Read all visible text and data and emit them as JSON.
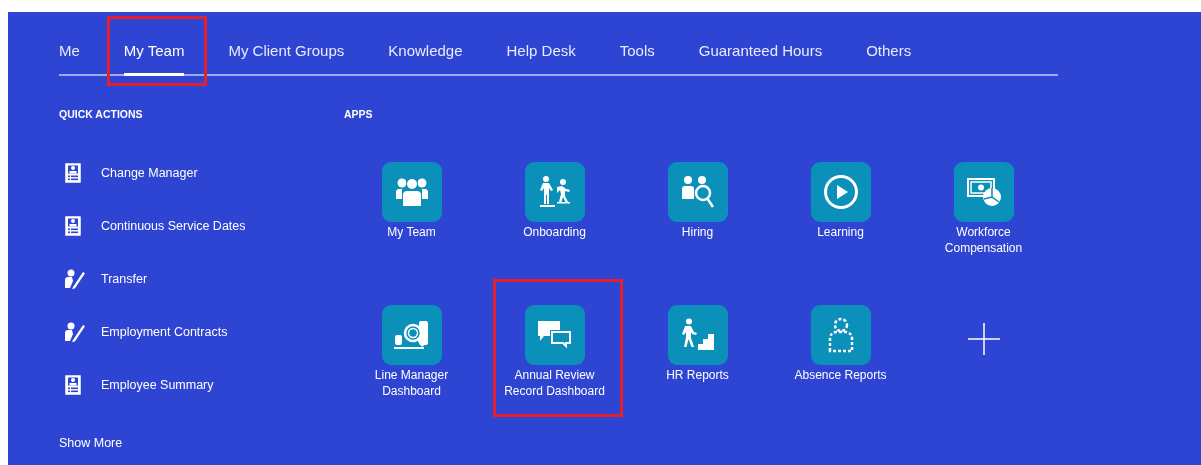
{
  "tabs": [
    {
      "label": "Me",
      "selected": false,
      "highlighted": false
    },
    {
      "label": "My Team",
      "selected": true,
      "highlighted": true
    },
    {
      "label": "My Client Groups",
      "selected": false,
      "highlighted": false
    },
    {
      "label": "Knowledge",
      "selected": false,
      "highlighted": false
    },
    {
      "label": "Help Desk",
      "selected": false,
      "highlighted": false
    },
    {
      "label": "Tools",
      "selected": false,
      "highlighted": false
    },
    {
      "label": "Guaranteed Hours",
      "selected": false,
      "highlighted": false
    },
    {
      "label": "Others",
      "selected": false,
      "highlighted": false
    }
  ],
  "quick_actions": {
    "heading": "QUICK ACTIONS",
    "items": [
      {
        "label": "Change Manager",
        "kind": "card"
      },
      {
        "label": "Continuous Service Dates",
        "kind": "card"
      },
      {
        "label": "Transfer",
        "kind": "edit"
      },
      {
        "label": "Employment Contracts",
        "kind": "edit"
      },
      {
        "label": "Employee Summary",
        "kind": "card"
      }
    ],
    "show_more": "Show More"
  },
  "apps": {
    "heading": "APPS",
    "items": [
      {
        "kind": "app",
        "label": "My Team",
        "highlighted": false
      },
      {
        "kind": "app",
        "label": "Onboarding",
        "highlighted": false
      },
      {
        "kind": "app",
        "label": "Hiring",
        "highlighted": false
      },
      {
        "kind": "app",
        "label": "Learning",
        "highlighted": false
      },
      {
        "kind": "app",
        "label": "Workforce Compensation",
        "highlighted": false
      },
      {
        "kind": "app",
        "label": "Line Manager Dashboard",
        "highlighted": false
      },
      {
        "kind": "app",
        "label": "Annual Review Record Dashboard",
        "highlighted": true
      },
      {
        "kind": "app",
        "label": "HR Reports",
        "highlighted": false
      },
      {
        "kind": "app",
        "label": "Absence Reports",
        "highlighted": false
      },
      {
        "kind": "add"
      }
    ]
  }
}
